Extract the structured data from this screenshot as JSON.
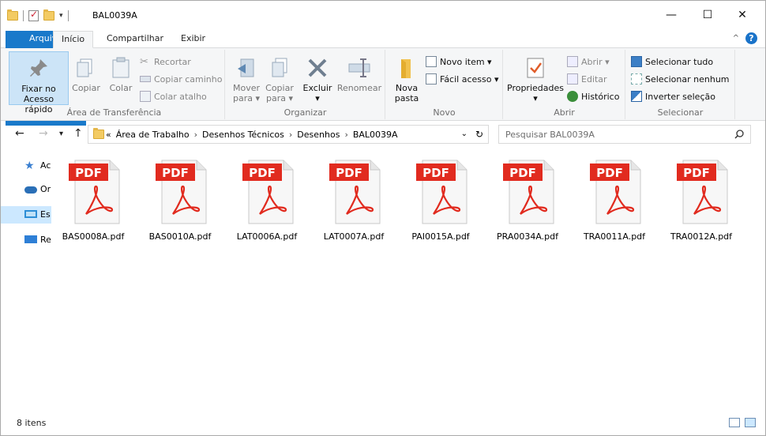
{
  "window": {
    "title": "BAL0039A",
    "controls": {
      "minimize": "—",
      "maximize": "☐",
      "close": "✕"
    }
  },
  "ribbon_tabs": [
    "Arquivo",
    "Início",
    "Compartilhar",
    "Exibir"
  ],
  "ribbon": {
    "clipboard": {
      "label": "Área de Transferência",
      "pin": "Fixar no Acesso rápido",
      "pin_line1": "Fixar no",
      "pin_line2": "Acesso rápido",
      "copy": "Copiar",
      "paste": "Colar",
      "cut": "Recortar",
      "copy_path": "Copiar caminho",
      "paste_shortcut": "Colar atalho"
    },
    "organize": {
      "label": "Organizar",
      "move_line1": "Mover",
      "move_line2": "para ▾",
      "copyto_line1": "Copiar",
      "copyto_line2": "para ▾",
      "delete": "Excluir",
      "delete_arrow": "▾",
      "rename": "Renomear"
    },
    "new": {
      "label": "Novo",
      "new_folder_line1": "Nova",
      "new_folder_line2": "pasta",
      "new_item": "Novo item ▾",
      "easy_access": "Fácil acesso ▾"
    },
    "open": {
      "label": "Abrir",
      "properties": "Propriedades",
      "properties_arrow": "▾",
      "open": "Abrir ▾",
      "edit": "Editar",
      "history": "Histórico"
    },
    "select": {
      "label": "Selecionar",
      "select_all": "Selecionar tudo",
      "select_none": "Selecionar nenhum",
      "invert": "Inverter seleção"
    }
  },
  "address": {
    "overflow": "«",
    "crumbs": [
      "Área de Trabalho",
      "Desenhos Técnicos",
      "Desenhos",
      "BAL0039A"
    ],
    "separator": "›"
  },
  "search": {
    "placeholder": "Pesquisar BAL0039A"
  },
  "nav_pane": [
    {
      "label": "Ac",
      "icon": "star-icon"
    },
    {
      "label": "Or",
      "icon": "onedrive-icon"
    },
    {
      "label": "Es",
      "icon": "computer-icon"
    },
    {
      "label": "Re",
      "icon": "network-icon"
    }
  ],
  "files": [
    "BAS0008A.pdf",
    "BAS0010A.pdf",
    "LAT0006A.pdf",
    "LAT0007A.pdf",
    "PAI0015A.pdf",
    "PRA0034A.pdf",
    "TRA0011A.pdf",
    "TRA0012A.pdf"
  ],
  "pdf_badge": "PDF",
  "status": {
    "count": "8 itens"
  },
  "colors": {
    "accent": "#1979ca",
    "pdf_red": "#e12b1f",
    "selection": "#cce8ff"
  }
}
